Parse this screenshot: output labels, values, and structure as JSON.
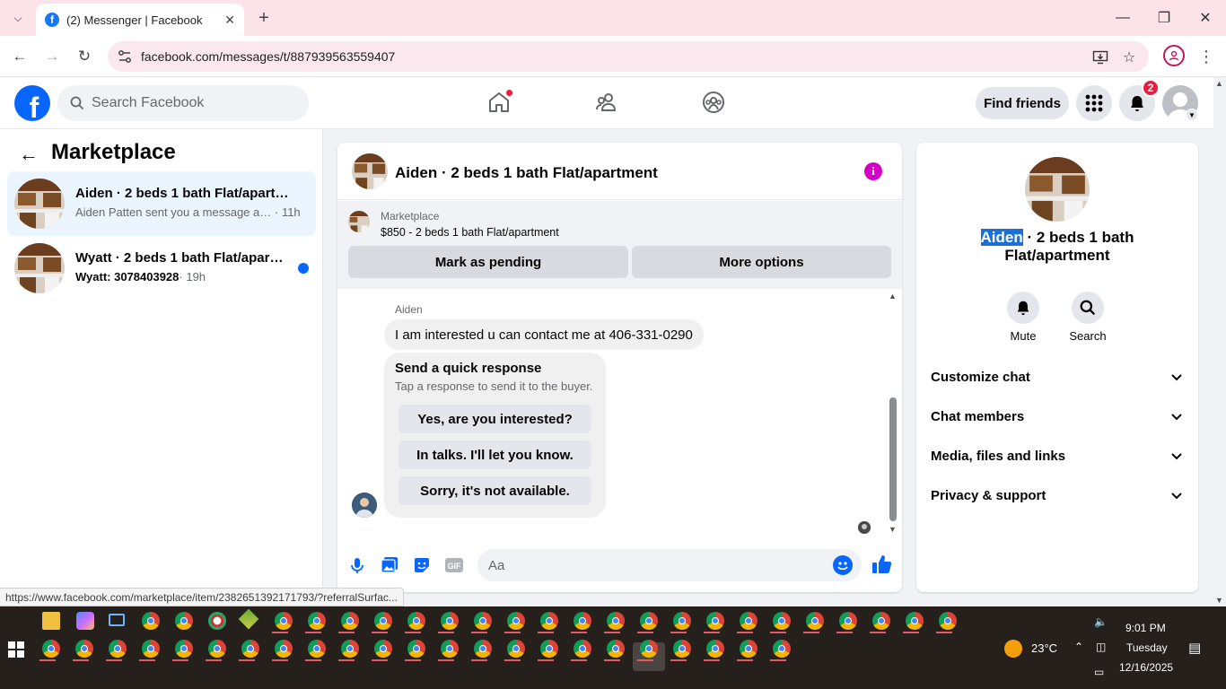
{
  "browser": {
    "tab_title": "(2) Messenger | Facebook",
    "url": "facebook.com/messages/t/887939563559407",
    "status_url": "https://www.facebook.com/marketplace/item/2382651392171793/?referralSurfac..."
  },
  "fb_header": {
    "search_placeholder": "Search Facebook",
    "find_friends": "Find friends",
    "notification_count": "2"
  },
  "sidebar": {
    "title": "Marketplace",
    "conversations": [
      {
        "title": "Aiden · 2 beds 1 bath Flat/apartment",
        "preview": "Aiden Patten sent you a message ab...",
        "time": "· 11h",
        "active": true
      },
      {
        "title": "Wyatt · 2 beds 1 bath Flat/apartment",
        "preview": "Wyatt: 3078403928",
        "time": "· 19h",
        "unread": true
      }
    ]
  },
  "chat": {
    "title": "Aiden · 2 beds 1 bath Flat/apartment",
    "marketplace_label": "Marketplace",
    "listing": "$850 - 2 beds 1 bath Flat/apartment",
    "actions": [
      "Mark as pending",
      "More options"
    ],
    "sender": "Aiden",
    "message": "I am interested u can contact me at 406-331-0290",
    "quick_title": "Send a quick response",
    "quick_subtitle": "Tap a response to send it to the buyer.",
    "quick_responses": [
      "Yes, are you interested?",
      "In talks. I'll let you know.",
      "Sorry, it's not available."
    ],
    "composer_placeholder": "Aa"
  },
  "details": {
    "name_highlight": "Aiden",
    "name_rest": " · 2 beds 1 bath Flat/apartment",
    "actions": [
      "Mute",
      "Search"
    ],
    "sections": [
      "Customize chat",
      "Chat members",
      "Media, files and links",
      "Privacy & support"
    ]
  },
  "taskbar": {
    "temperature": "23°C",
    "time": "9:01 PM",
    "day": "Tuesday",
    "date": "12/16/2025"
  },
  "colors": {
    "fb_blue": "#0866ff",
    "info_magenta": "#d300c5",
    "badge_red": "#e41e3f",
    "active_conversation": "#ebf5ff"
  }
}
